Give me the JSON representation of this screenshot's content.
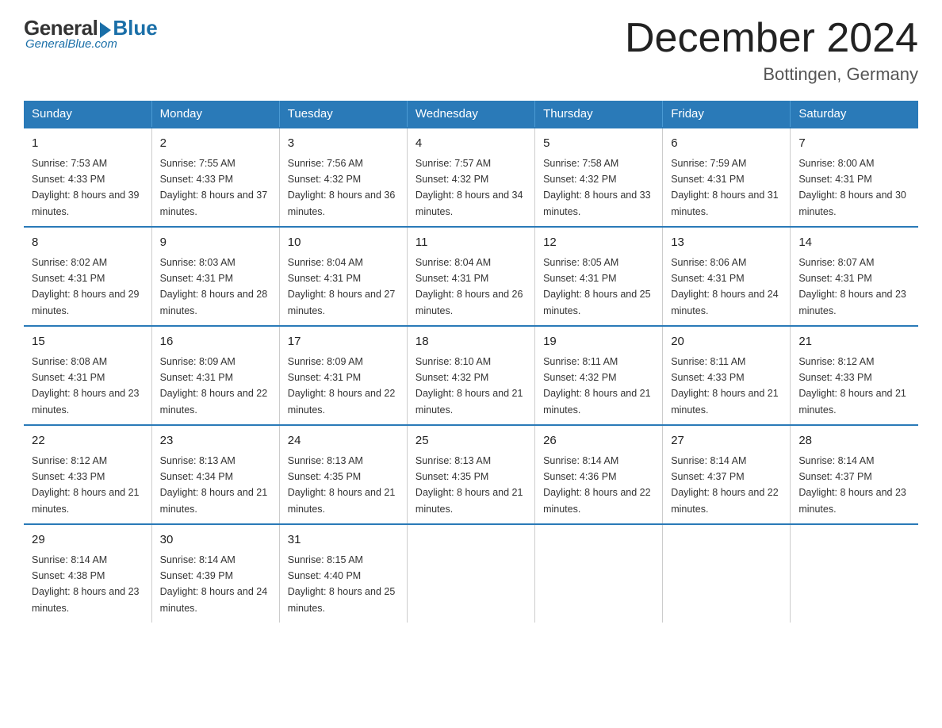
{
  "logo": {
    "general": "General",
    "blue": "Blue",
    "subtitle": "GeneralBlue.com"
  },
  "title": "December 2024",
  "subtitle": "Bottingen, Germany",
  "days_header": [
    "Sunday",
    "Monday",
    "Tuesday",
    "Wednesday",
    "Thursday",
    "Friday",
    "Saturday"
  ],
  "weeks": [
    [
      {
        "day": "1",
        "sunrise": "7:53 AM",
        "sunset": "4:33 PM",
        "daylight": "8 hours and 39 minutes."
      },
      {
        "day": "2",
        "sunrise": "7:55 AM",
        "sunset": "4:33 PM",
        "daylight": "8 hours and 37 minutes."
      },
      {
        "day": "3",
        "sunrise": "7:56 AM",
        "sunset": "4:32 PM",
        "daylight": "8 hours and 36 minutes."
      },
      {
        "day": "4",
        "sunrise": "7:57 AM",
        "sunset": "4:32 PM",
        "daylight": "8 hours and 34 minutes."
      },
      {
        "day": "5",
        "sunrise": "7:58 AM",
        "sunset": "4:32 PM",
        "daylight": "8 hours and 33 minutes."
      },
      {
        "day": "6",
        "sunrise": "7:59 AM",
        "sunset": "4:31 PM",
        "daylight": "8 hours and 31 minutes."
      },
      {
        "day": "7",
        "sunrise": "8:00 AM",
        "sunset": "4:31 PM",
        "daylight": "8 hours and 30 minutes."
      }
    ],
    [
      {
        "day": "8",
        "sunrise": "8:02 AM",
        "sunset": "4:31 PM",
        "daylight": "8 hours and 29 minutes."
      },
      {
        "day": "9",
        "sunrise": "8:03 AM",
        "sunset": "4:31 PM",
        "daylight": "8 hours and 28 minutes."
      },
      {
        "day": "10",
        "sunrise": "8:04 AM",
        "sunset": "4:31 PM",
        "daylight": "8 hours and 27 minutes."
      },
      {
        "day": "11",
        "sunrise": "8:04 AM",
        "sunset": "4:31 PM",
        "daylight": "8 hours and 26 minutes."
      },
      {
        "day": "12",
        "sunrise": "8:05 AM",
        "sunset": "4:31 PM",
        "daylight": "8 hours and 25 minutes."
      },
      {
        "day": "13",
        "sunrise": "8:06 AM",
        "sunset": "4:31 PM",
        "daylight": "8 hours and 24 minutes."
      },
      {
        "day": "14",
        "sunrise": "8:07 AM",
        "sunset": "4:31 PM",
        "daylight": "8 hours and 23 minutes."
      }
    ],
    [
      {
        "day": "15",
        "sunrise": "8:08 AM",
        "sunset": "4:31 PM",
        "daylight": "8 hours and 23 minutes."
      },
      {
        "day": "16",
        "sunrise": "8:09 AM",
        "sunset": "4:31 PM",
        "daylight": "8 hours and 22 minutes."
      },
      {
        "day": "17",
        "sunrise": "8:09 AM",
        "sunset": "4:31 PM",
        "daylight": "8 hours and 22 minutes."
      },
      {
        "day": "18",
        "sunrise": "8:10 AM",
        "sunset": "4:32 PM",
        "daylight": "8 hours and 21 minutes."
      },
      {
        "day": "19",
        "sunrise": "8:11 AM",
        "sunset": "4:32 PM",
        "daylight": "8 hours and 21 minutes."
      },
      {
        "day": "20",
        "sunrise": "8:11 AM",
        "sunset": "4:33 PM",
        "daylight": "8 hours and 21 minutes."
      },
      {
        "day": "21",
        "sunrise": "8:12 AM",
        "sunset": "4:33 PM",
        "daylight": "8 hours and 21 minutes."
      }
    ],
    [
      {
        "day": "22",
        "sunrise": "8:12 AM",
        "sunset": "4:33 PM",
        "daylight": "8 hours and 21 minutes."
      },
      {
        "day": "23",
        "sunrise": "8:13 AM",
        "sunset": "4:34 PM",
        "daylight": "8 hours and 21 minutes."
      },
      {
        "day": "24",
        "sunrise": "8:13 AM",
        "sunset": "4:35 PM",
        "daylight": "8 hours and 21 minutes."
      },
      {
        "day": "25",
        "sunrise": "8:13 AM",
        "sunset": "4:35 PM",
        "daylight": "8 hours and 21 minutes."
      },
      {
        "day": "26",
        "sunrise": "8:14 AM",
        "sunset": "4:36 PM",
        "daylight": "8 hours and 22 minutes."
      },
      {
        "day": "27",
        "sunrise": "8:14 AM",
        "sunset": "4:37 PM",
        "daylight": "8 hours and 22 minutes."
      },
      {
        "day": "28",
        "sunrise": "8:14 AM",
        "sunset": "4:37 PM",
        "daylight": "8 hours and 23 minutes."
      }
    ],
    [
      {
        "day": "29",
        "sunrise": "8:14 AM",
        "sunset": "4:38 PM",
        "daylight": "8 hours and 23 minutes."
      },
      {
        "day": "30",
        "sunrise": "8:14 AM",
        "sunset": "4:39 PM",
        "daylight": "8 hours and 24 minutes."
      },
      {
        "day": "31",
        "sunrise": "8:15 AM",
        "sunset": "4:40 PM",
        "daylight": "8 hours and 25 minutes."
      },
      null,
      null,
      null,
      null
    ]
  ]
}
